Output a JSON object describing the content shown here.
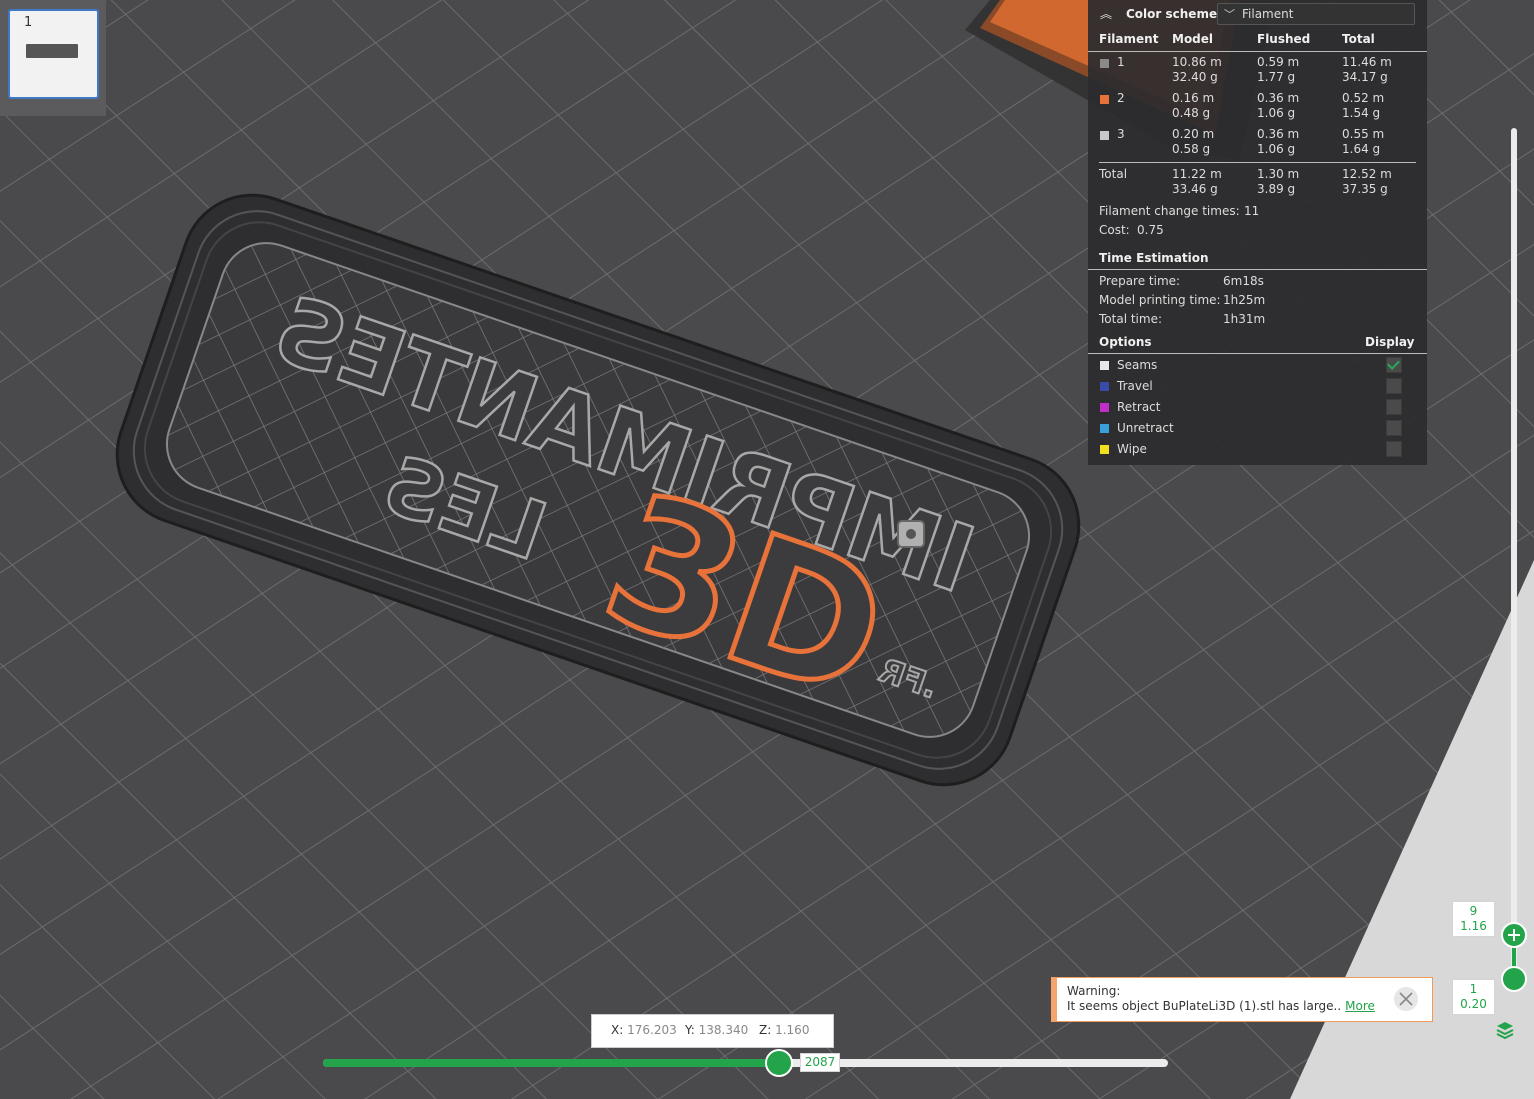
{
  "plate": {
    "number": "1"
  },
  "legend": {
    "color_scheme_label": "Color scheme",
    "color_scheme_value": "Filament",
    "headers": {
      "filament": "Filament",
      "model": "Model",
      "flushed": "Flushed",
      "total": "Total"
    },
    "rows": [
      {
        "id": "1",
        "color": "#8a8a8a",
        "model_m": "10.86 m",
        "model_g": "32.40 g",
        "flushed_m": "0.59 m",
        "flushed_g": "1.77 g",
        "total_m": "11.46 m",
        "total_g": "34.17 g"
      },
      {
        "id": "2",
        "color": "#e8733a",
        "model_m": "0.16 m",
        "model_g": "0.48 g",
        "flushed_m": "0.36 m",
        "flushed_g": "1.06 g",
        "total_m": "0.52 m",
        "total_g": "1.54 g"
      },
      {
        "id": "3",
        "color": "#c8c8c8",
        "model_m": "0.20 m",
        "model_g": "0.58 g",
        "flushed_m": "0.36 m",
        "flushed_g": "1.06 g",
        "total_m": "0.55 m",
        "total_g": "1.64 g"
      }
    ],
    "total": {
      "label": "Total",
      "model_m": "11.22 m",
      "model_g": "33.46 g",
      "flushed_m": "1.30 m",
      "flushed_g": "3.89 g",
      "total_m": "12.52 m",
      "total_g": "37.35 g"
    },
    "filament_change_label": "Filament change times:",
    "filament_change_value": "11",
    "cost_label": "Cost:",
    "cost_value": "0.75",
    "time_title": "Time Estimation",
    "prepare_label": "Prepare time:",
    "prepare_value": "6m18s",
    "model_time_label": "Model printing time:",
    "model_time_value": "1h25m",
    "total_time_label": "Total time:",
    "total_time_value": "1h31m",
    "options_title": "Options",
    "display_title": "Display",
    "options": [
      {
        "label": "Seams",
        "color": "#e8e8e8",
        "checked": true
      },
      {
        "label": "Travel",
        "color": "#3a4aa8",
        "checked": false
      },
      {
        "label": "Retract",
        "color": "#c030c8",
        "checked": false
      },
      {
        "label": "Unretract",
        "color": "#3aa0d8",
        "checked": false
      },
      {
        "label": "Wipe",
        "color": "#f0e020",
        "checked": false
      }
    ]
  },
  "layer_slider": {
    "top_layer": "9",
    "top_height": "1.16",
    "bottom_layer": "1",
    "bottom_height": "0.20"
  },
  "warning": {
    "title": "Warning:",
    "message": "It seems object BuPlateLi3D (1).stl has large..",
    "link": "More"
  },
  "coords": {
    "x_label": "X:",
    "x": "176.203",
    "y_label": "Y:",
    "y": "138.340",
    "z_label": "Z:",
    "z": "1.160"
  },
  "move_slider": {
    "value": "2087",
    "progress": 0.54
  },
  "model": {
    "text_main": "IMPRIMANTES",
    "text_sub": "LES",
    "text_3d": "3D",
    "text_fr": ".FR"
  },
  "colors": {
    "accent": "#23a34a",
    "background": "#4a4a4c",
    "filament_orange": "#e8733a"
  }
}
